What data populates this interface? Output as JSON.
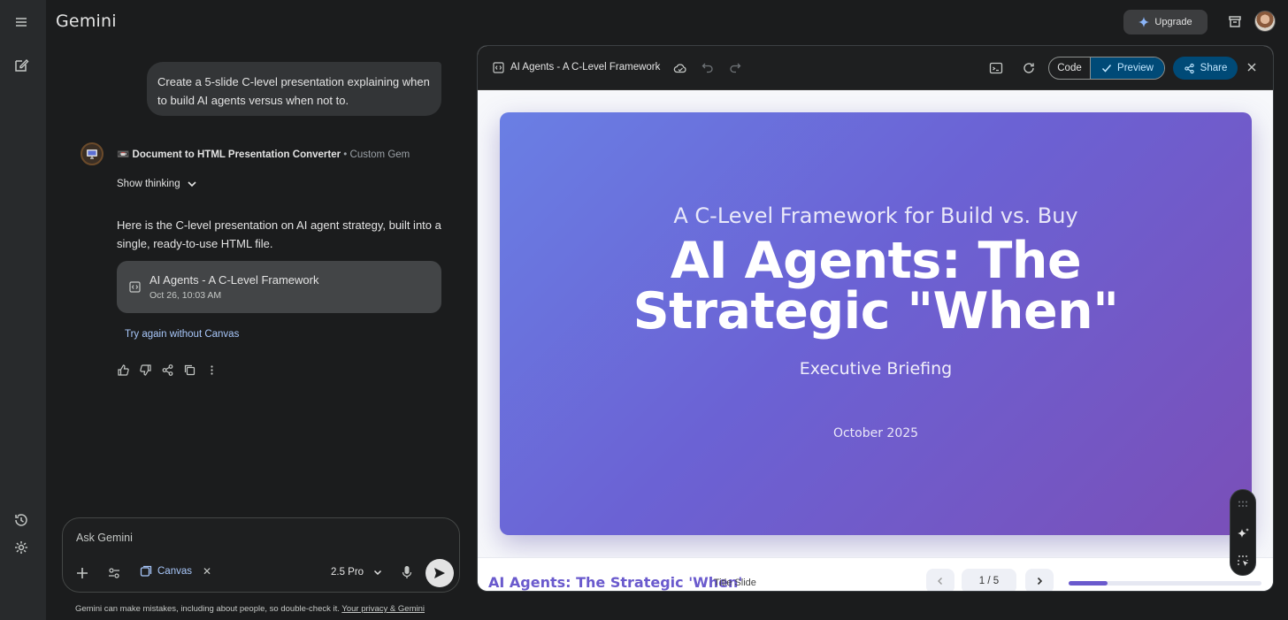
{
  "app": {
    "brand": "Gemini",
    "upgrade_label": "Upgrade"
  },
  "chat": {
    "user_prompt": "Create a 5-slide C-level presentation explaining when to build AI agents versus when not to.",
    "gem_name": "Document to HTML Presentation Converter",
    "gem_separator": " • ",
    "gem_type": "Custom Gem",
    "show_thinking": "Show thinking",
    "response_text": "Here is the C-level presentation on AI agent strategy, built into a single, ready-to-use HTML file.",
    "doc_card": {
      "title": "AI Agents - A C-Level Framework",
      "timestamp": "Oct 26, 10:03 AM"
    },
    "try_again": "Try again without Canvas"
  },
  "input": {
    "placeholder": "Ask Gemini",
    "canvas_chip": "Canvas",
    "model": "2.5 Pro"
  },
  "disclaimer": {
    "text": "Gemini can make mistakes, including about people, so double-check it. ",
    "link": "Your privacy & Gemini"
  },
  "canvas": {
    "title": "AI Agents - A C-Level Framework",
    "code_label": "Code",
    "preview_label": "Preview",
    "share_label": "Share",
    "slide": {
      "subtitle": "A C-Level Framework for Build vs. Buy",
      "headline": "AI Agents: The Strategic \"When\"",
      "briefing": "Executive Briefing",
      "date": "October 2025"
    },
    "footer": {
      "deck_title": "AI Agents: The Strategic 'When'",
      "slide_type": "Title Slide",
      "counter": "1 / 5",
      "progress_fraction": 0.2
    }
  },
  "colors": {
    "accent": "#6a5acd",
    "link": "#a8c7fa",
    "share_bg": "#004a77"
  }
}
